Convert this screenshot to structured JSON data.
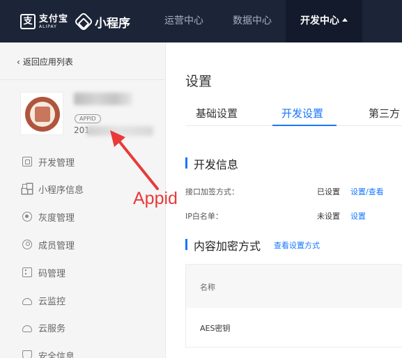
{
  "brand": {
    "alipay_mark": "支",
    "alipay_cn": "支付宝",
    "alipay_en": "ALIPAY",
    "product": "小程序"
  },
  "nav": {
    "ops": "运营中心",
    "data": "数据中心",
    "dev": "开发中心"
  },
  "sidebar": {
    "back": "返回应用列表",
    "appid_badge": "APPID",
    "appid_prefix": "201",
    "items": [
      {
        "label": "开发管理",
        "icon": "code-window-icon"
      },
      {
        "label": "小程序信息",
        "icon": "grid-icon"
      },
      {
        "label": "灰度管理",
        "icon": "broadcast-icon"
      },
      {
        "label": "成员管理",
        "icon": "user-icon"
      },
      {
        "label": "码管理",
        "icon": "qrcode-icon"
      },
      {
        "label": "云监控",
        "icon": "cloud-icon"
      },
      {
        "label": "云服务",
        "icon": "cloud-icon"
      },
      {
        "label": "安全信息",
        "icon": "shield-icon"
      }
    ]
  },
  "main": {
    "title": "设置",
    "tabs": [
      "基础设置",
      "开发设置",
      "第三方"
    ],
    "active_tab": "开发设置",
    "dev_info_title": "开发信息",
    "rows": [
      {
        "label": "接口加签方式：",
        "status": "已设置",
        "link": "设置/查看"
      },
      {
        "label": "IP白名单：",
        "status": "未设置",
        "link": "设置"
      }
    ],
    "enc_title": "内容加密方式",
    "enc_link": "查看设置方式",
    "table_header": "名称",
    "table_row": "AES密钥"
  },
  "annotation": {
    "text": "Appid",
    "color": "#e83a3a"
  },
  "colors": {
    "topbar": "#1c2437",
    "accent": "#1677ff"
  }
}
